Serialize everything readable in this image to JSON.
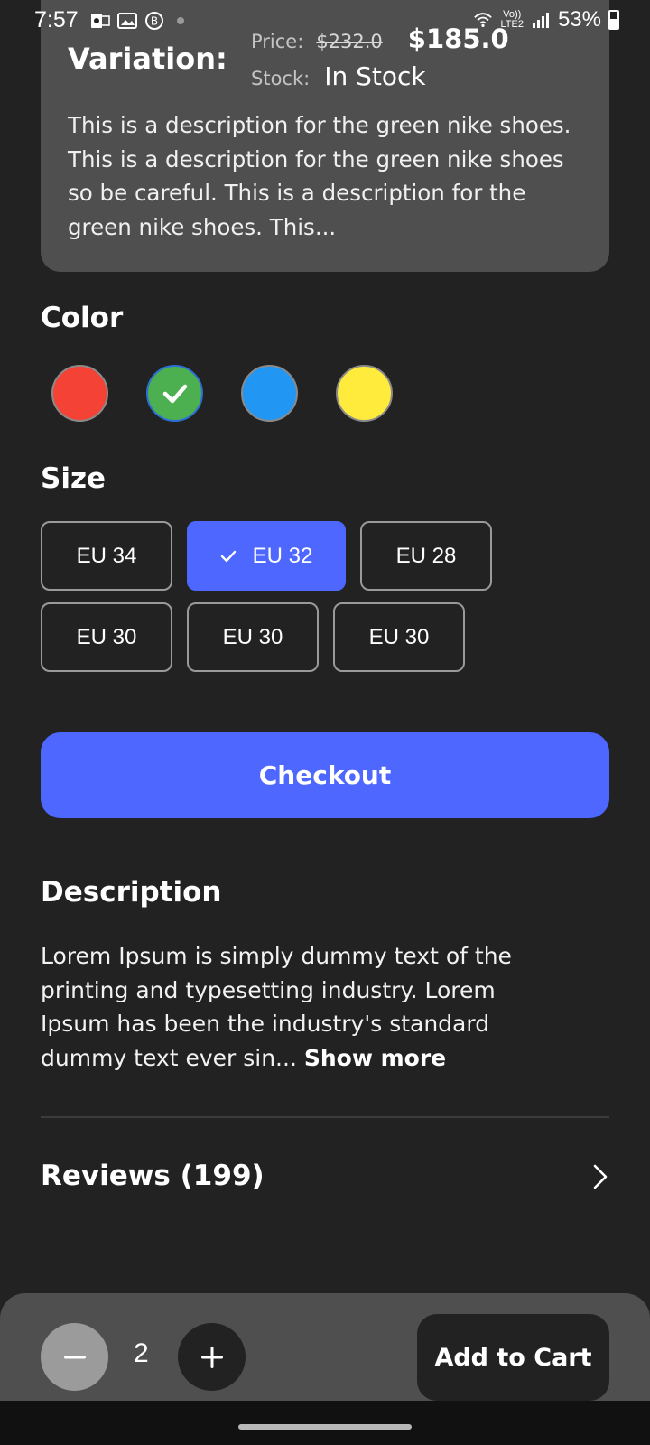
{
  "status_bar": {
    "time": "7:57",
    "lte_top": "Vo))",
    "lte_bottom": "LTE2",
    "battery": "53%"
  },
  "variation": {
    "title": "Variation:",
    "price_label": "Price:",
    "old_price": "$232.0",
    "new_price": "$185.0",
    "stock_label": "Stock:",
    "stock_value": "In Stock",
    "description": "This is a description for the green nike shoes. This is a description for the green nike shoes so be careful. This is a description for the green nike shoes. This..."
  },
  "color_section": {
    "title": "Color",
    "swatches": [
      {
        "color": "#f44336",
        "selected": false
      },
      {
        "color": "#4caf50",
        "selected": true
      },
      {
        "color": "#2196f3",
        "selected": false
      },
      {
        "color": "#ffeb3b",
        "selected": false
      }
    ]
  },
  "size_section": {
    "title": "Size",
    "sizes": [
      {
        "label": "EU 34",
        "selected": false
      },
      {
        "label": "EU 32",
        "selected": true
      },
      {
        "label": "EU 28",
        "selected": false
      },
      {
        "label": "EU 30",
        "selected": false
      },
      {
        "label": "EU 30",
        "selected": false
      },
      {
        "label": "EU 30",
        "selected": false
      }
    ]
  },
  "checkout": {
    "label": "Checkout"
  },
  "description": {
    "title": "Description",
    "text": "Lorem Ipsum is simply dummy text of the printing and typesetting industry. Lorem Ipsum has been the industry's standard dummy text ever sin... ",
    "show_more": "Show more"
  },
  "reviews": {
    "label": "Reviews (199)"
  },
  "bottom_bar": {
    "quantity": "2",
    "add_to_cart": "Add to Cart"
  },
  "colors": {
    "background": "#222222",
    "card": "#4f4f4f",
    "accent": "#4d67ff"
  }
}
